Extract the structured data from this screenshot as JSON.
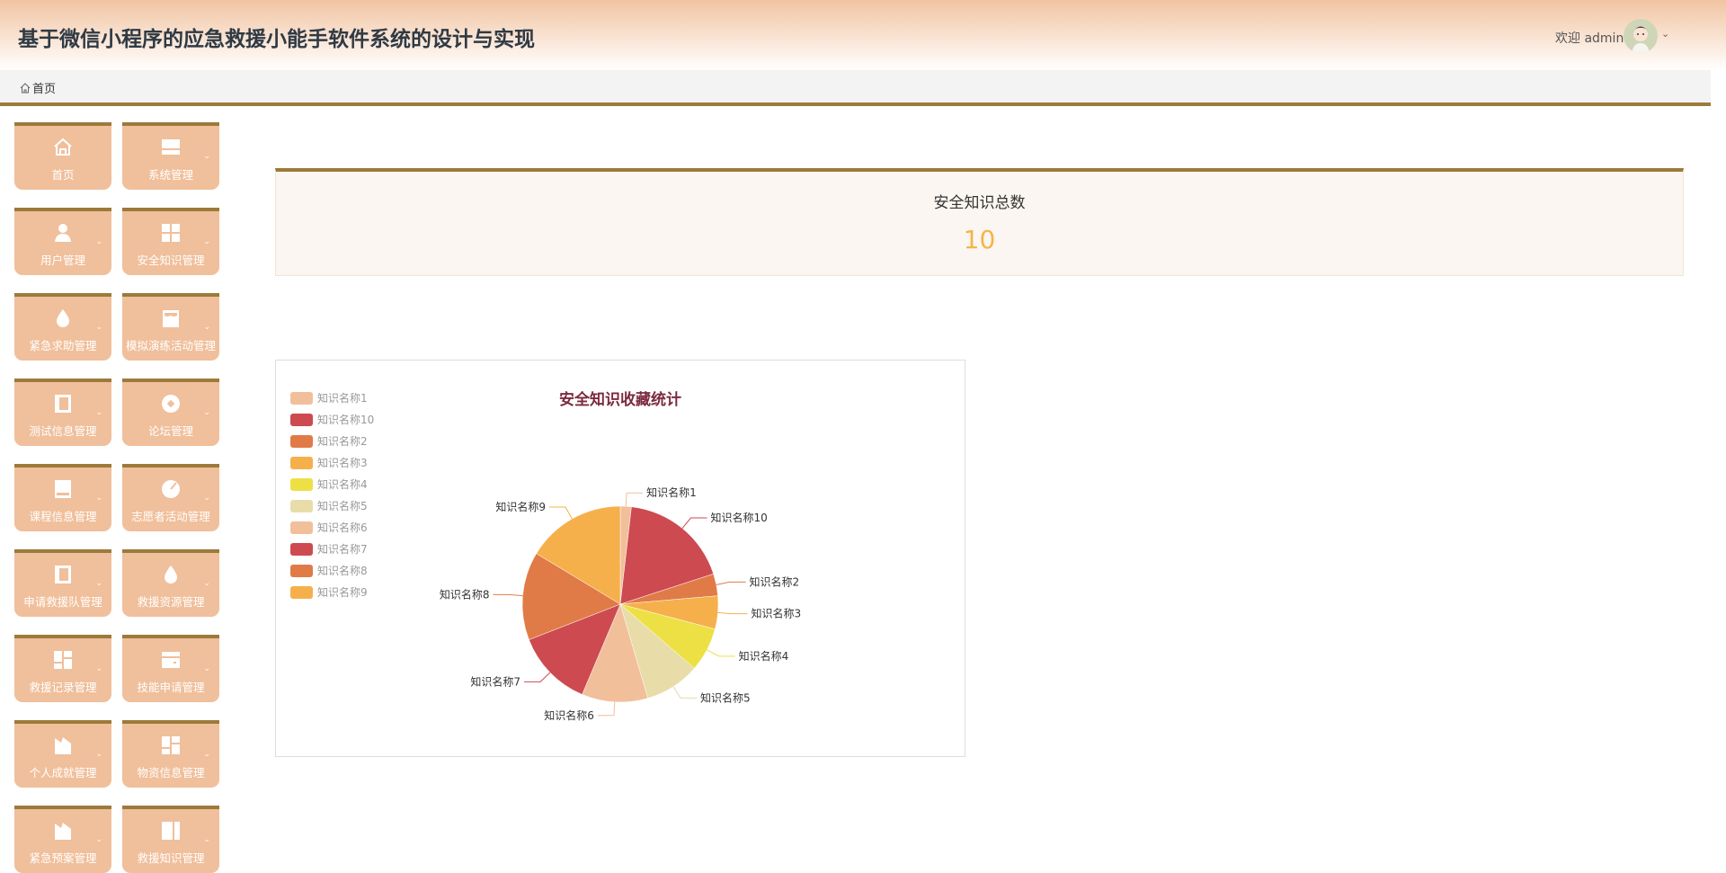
{
  "header": {
    "title": "基于微信小程序的应急救援小能手软件系统的设计与实现",
    "welcome": "欢迎 admin"
  },
  "breadcrumb": {
    "home": "首页"
  },
  "sidebar": {
    "items": [
      {
        "label": "首页",
        "icon": "home-icon",
        "dropdown": false
      },
      {
        "label": "系统管理",
        "icon": "layout-icon",
        "dropdown": true
      },
      {
        "label": "用户管理",
        "icon": "user-icon",
        "dropdown": true
      },
      {
        "label": "安全知识管理",
        "icon": "grid-icon",
        "dropdown": true
      },
      {
        "label": "紧急求助管理",
        "icon": "drop-icon",
        "dropdown": true
      },
      {
        "label": "模拟演练活动管理",
        "icon": "shop-icon",
        "dropdown": true
      },
      {
        "label": "测试信息管理",
        "icon": "book-icon",
        "dropdown": true
      },
      {
        "label": "论坛管理",
        "icon": "coin-icon",
        "dropdown": true
      },
      {
        "label": "课程信息管理",
        "icon": "drive-icon",
        "dropdown": true
      },
      {
        "label": "志愿者活动管理",
        "icon": "gauge-icon",
        "dropdown": true
      },
      {
        "label": "申请救援队管理",
        "icon": "book-icon",
        "dropdown": true
      },
      {
        "label": "救援资源管理",
        "icon": "drop-icon",
        "dropdown": true
      },
      {
        "label": "救援记录管理",
        "icon": "dashboard-icon",
        "dropdown": true
      },
      {
        "label": "技能申请管理",
        "icon": "wallet-icon",
        "dropdown": true
      },
      {
        "label": "个人成就管理",
        "icon": "factory-icon",
        "dropdown": true
      },
      {
        "label": "物资信息管理",
        "icon": "dashboard-icon",
        "dropdown": true
      },
      {
        "label": "紧急预案管理",
        "icon": "factory-icon",
        "dropdown": true
      },
      {
        "label": "救援知识管理",
        "icon": "columns-icon",
        "dropdown": true
      }
    ]
  },
  "stat": {
    "title": "安全知识总数",
    "value": "10"
  },
  "chart_data": {
    "type": "pie",
    "title": "安全知识收藏统计",
    "legend_position": "top-left",
    "categories": [
      "知识名称1",
      "知识名称10",
      "知识名称2",
      "知识名称3",
      "知识名称4",
      "知识名称5",
      "知识名称6",
      "知识名称7",
      "知识名称8",
      "知识名称9"
    ],
    "values": [
      1,
      10,
      2,
      3,
      4,
      5,
      6,
      7,
      8,
      9
    ],
    "colors": [
      "#f2bf9b",
      "#cd4a51",
      "#e07b47",
      "#f6b04b",
      "#ede045",
      "#e8dca9"
    ]
  }
}
